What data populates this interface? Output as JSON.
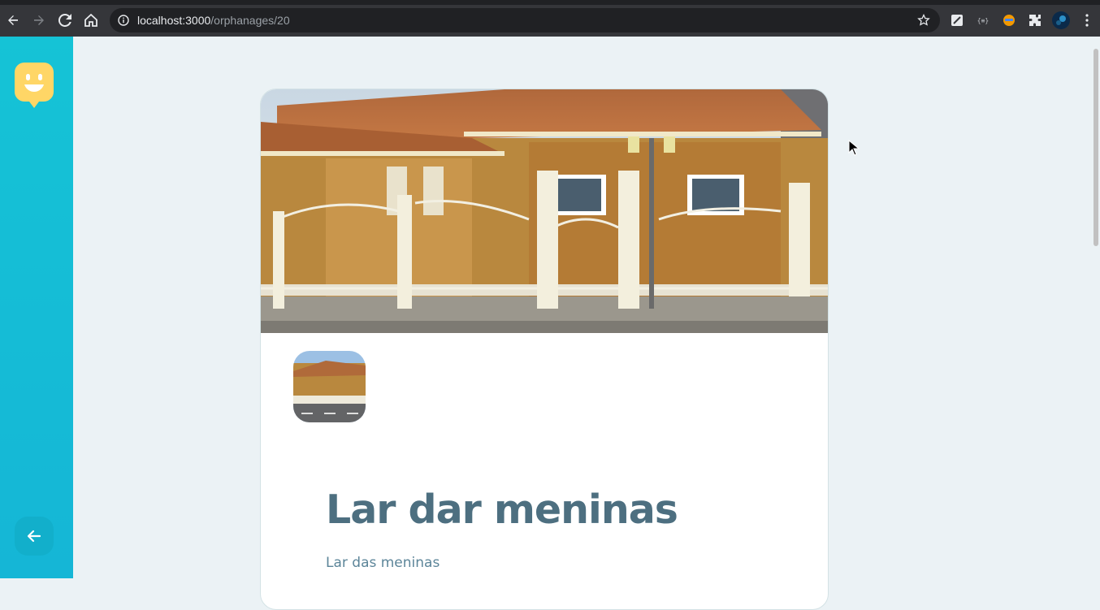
{
  "browser": {
    "url_host": "localhost:3000",
    "url_path": "/orphanages/20"
  },
  "sidebar": {
    "logo_icon": "happy-face-icon",
    "back_icon": "arrow-left-icon",
    "accent": "#15c3d6",
    "logo_color": "#ffd666"
  },
  "orphanage": {
    "name": "Lar dar meninas",
    "about": "Lar das meninas"
  },
  "colors": {
    "title": "#4d6f80",
    "text": "#5c8599",
    "background": "#ebf2f5"
  }
}
